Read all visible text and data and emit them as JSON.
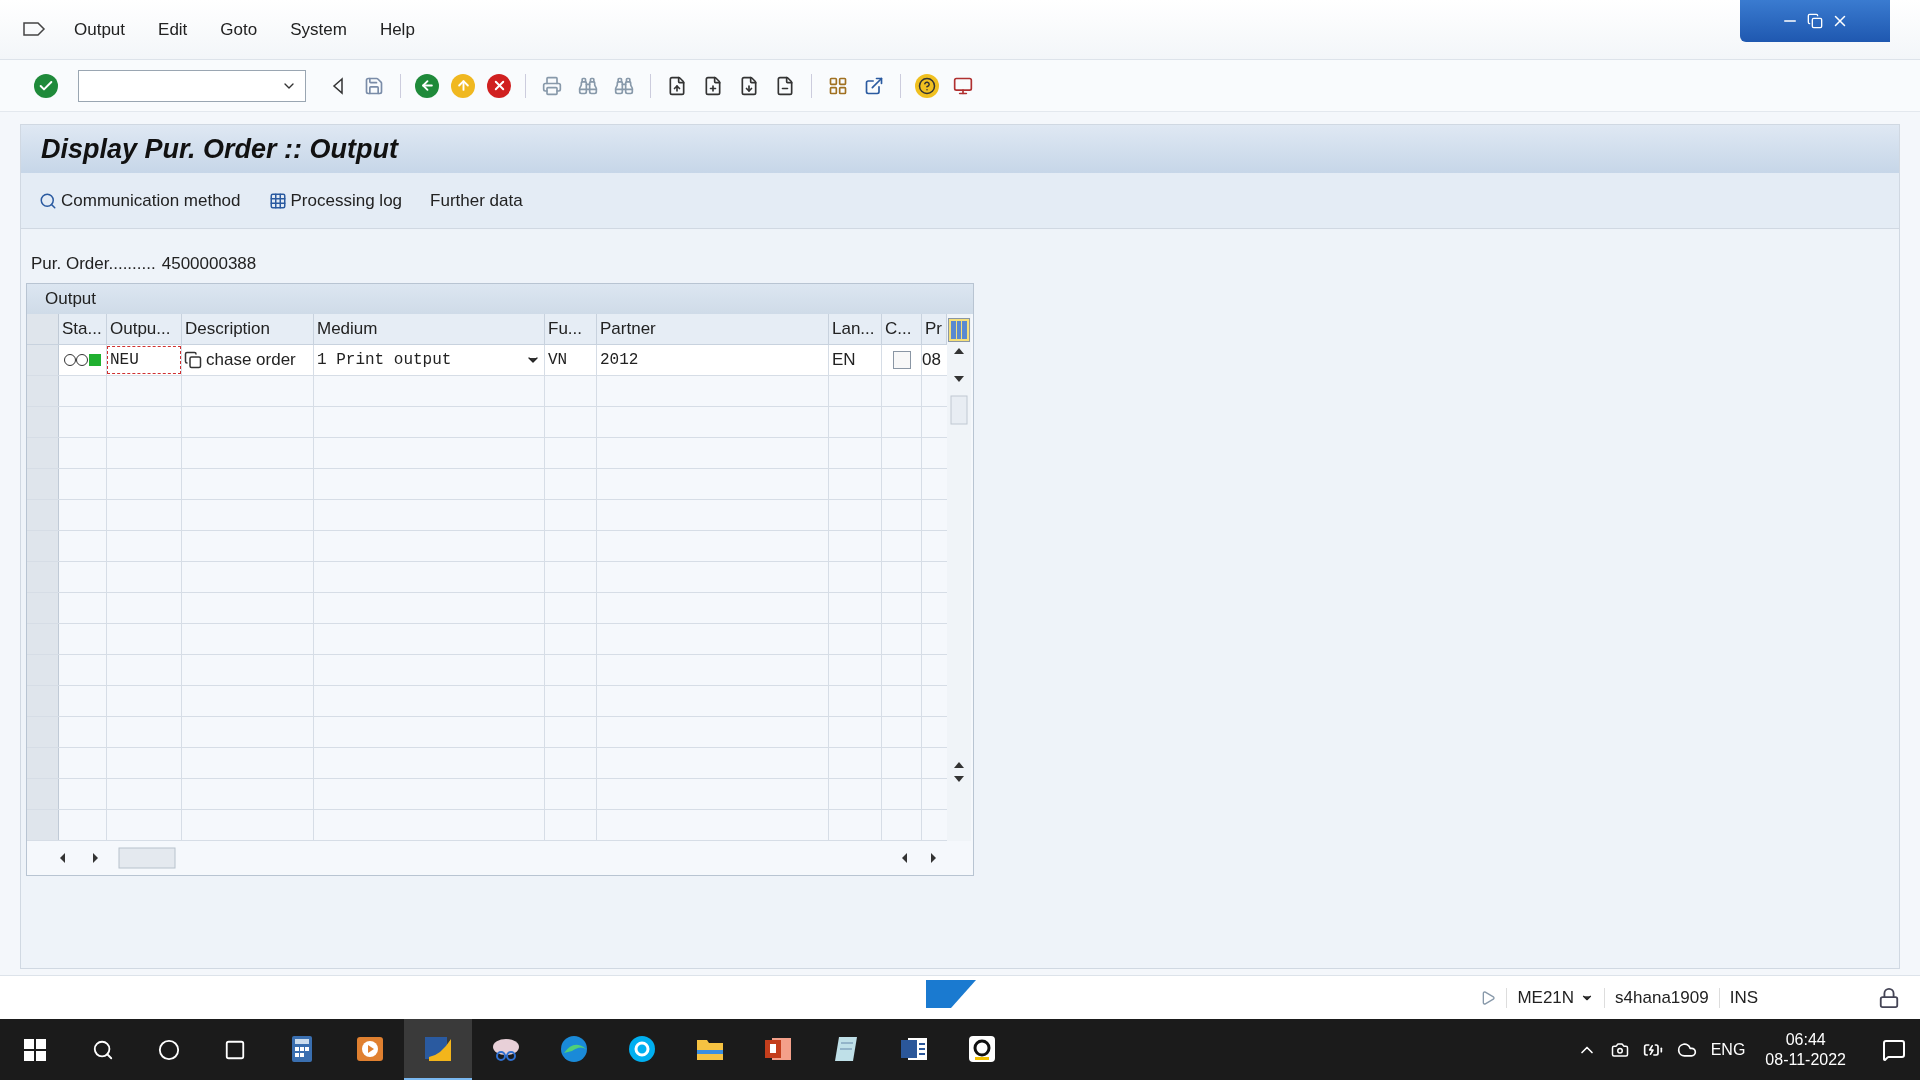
{
  "menu": [
    {
      "label": "Output"
    },
    {
      "label": "Edit"
    },
    {
      "label": "Goto"
    },
    {
      "label": "System"
    },
    {
      "label": "Help"
    }
  ],
  "title": "Display Pur. Order :: Output",
  "app_toolbar": [
    {
      "label": "Communication method",
      "kind": "search"
    },
    {
      "label": "Processing log",
      "kind": "grid"
    },
    {
      "label": "Further data",
      "kind": "plain"
    }
  ],
  "pur_order": {
    "label": "Pur. Order..........",
    "value": "4500000388"
  },
  "table": {
    "title": "Output",
    "columns": [
      "Sta...",
      "Outpu...",
      "Description",
      "Medium",
      "Fu...",
      "Partner",
      "Lan...",
      "C...",
      "Pr"
    ],
    "rows": [
      {
        "color": "#20b030",
        "output": "NEU",
        "description": "chase order",
        "medium": "1 Print output",
        "function": "VN",
        "partner": "2012",
        "language": "EN",
        "checked": false,
        "column_9": "08"
      }
    ]
  },
  "status_bar": {
    "transaction": "ME21N",
    "system": "s4hana1909",
    "mode": "INS"
  },
  "taskbar": {
    "apps": [
      {
        "kind": "calculator",
        "selected": false
      },
      {
        "kind": "media",
        "selected": false
      },
      {
        "kind": "sap",
        "selected": true
      },
      {
        "kind": "snip",
        "selected": false
      },
      {
        "kind": "edge",
        "selected": false
      },
      {
        "kind": "skype",
        "selected": false
      },
      {
        "kind": "folder",
        "selected": false
      },
      {
        "kind": "powerpoint",
        "selected": false
      },
      {
        "kind": "notepad",
        "selected": false
      },
      {
        "kind": "word",
        "selected": false
      },
      {
        "kind": "g",
        "selected": false
      }
    ],
    "language": "ENG",
    "time": "06:44",
    "date": "08-11-2022"
  }
}
